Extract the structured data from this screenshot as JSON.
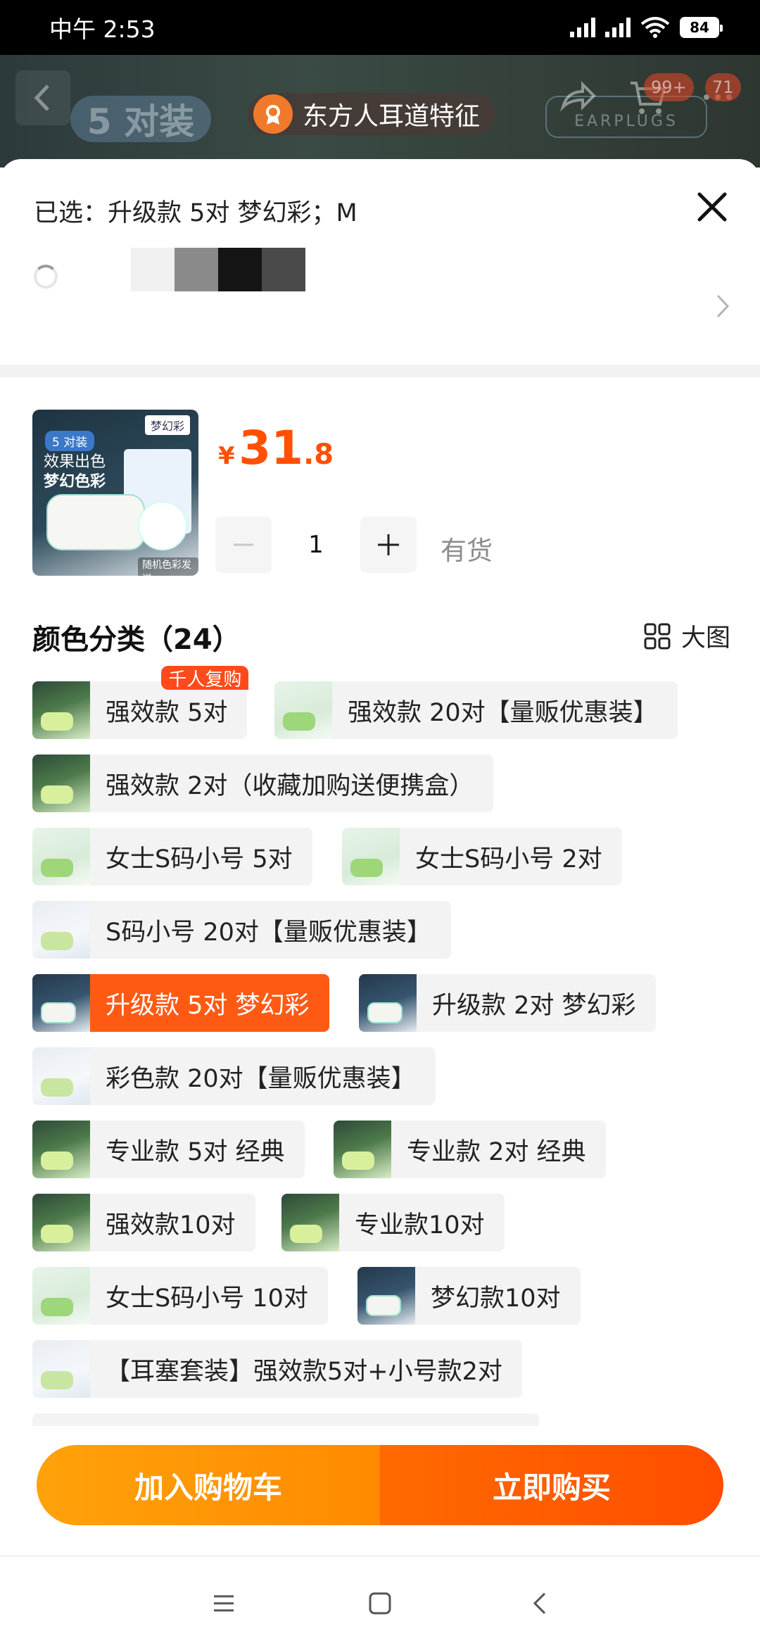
{
  "status_bar": {
    "time": "中午 2:53",
    "battery": "84"
  },
  "background_page": {
    "badge_text": "东方人耳道特征",
    "pack_label": "5 对装",
    "brand_tag": "EARPLUGS",
    "cart_count": "99+",
    "msg_count": "71"
  },
  "sheet": {
    "selected_text": "已选：升级款 5对 梦幻彩；M",
    "product_image_texts": {
      "tag": "梦幻彩",
      "pack": "5 对装",
      "line1": "效果出色",
      "line2": "梦幻色彩",
      "foot": "随机色彩发送"
    },
    "price": {
      "currency": "¥",
      "integer": "31",
      "decimal": ".8"
    },
    "quantity": "1",
    "stock_text": "有货",
    "section_title": "颜色分类（24）",
    "big_image_label": "大图"
  },
  "options": [
    {
      "label": "强效款 5对",
      "badge": "千人复购"
    },
    {
      "label": "强效款 20对【量贩优惠装】"
    },
    {
      "label": "强效款 2对（收藏加购送便携盒）"
    },
    {
      "label": "女士S码小号 5对"
    },
    {
      "label": "女士S码小号 2对"
    },
    {
      "label": "S码小号 20对【量贩优惠装】"
    },
    {
      "label": "升级款 5对 梦幻彩"
    },
    {
      "label": "升级款 2对 梦幻彩"
    },
    {
      "label": "彩色款 20对【量贩优惠装】"
    },
    {
      "label": "专业款 5对 经典"
    },
    {
      "label": "专业款 2对 经典"
    },
    {
      "label": "强效款10对"
    },
    {
      "label": "专业款10对"
    },
    {
      "label": "女士S码小号 10对"
    },
    {
      "label": "梦幻款10对"
    },
    {
      "label": "【耳塞套装】强效款5对+小号款2对"
    }
  ],
  "actions": {
    "add_to_cart": "加入购物车",
    "buy_now": "立即购买"
  },
  "colors": {
    "accent": "#ff5000",
    "cart_button": "#ff9800",
    "buy_button": "#ff5a00"
  }
}
